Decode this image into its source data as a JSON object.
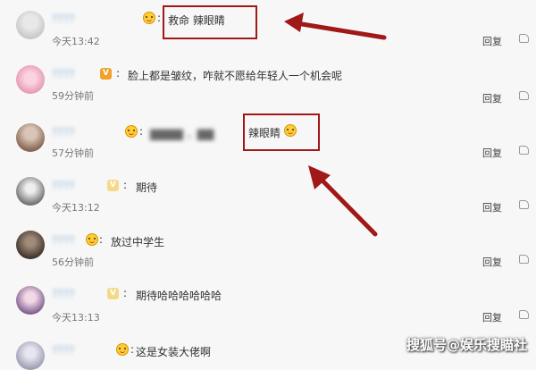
{
  "comments": [
    {
      "name": "????",
      "text": "救命 辣眼睛",
      "time": "今天13:42",
      "reply": "回复"
    },
    {
      "name": "????",
      "text": "脸上都是皱纹，咋就不愿给年轻人一个机会呢",
      "time": "59分钟前",
      "reply": "回复"
    },
    {
      "name": "????",
      "text": "辣眼睛",
      "time": "57分钟前",
      "reply": "回复"
    },
    {
      "name": "????",
      "text": "期待",
      "time": "今天13:12",
      "reply": "回复"
    },
    {
      "name": "????",
      "text": "放过中学生",
      "time": "56分钟前",
      "reply": "回复"
    },
    {
      "name": "????",
      "text": "期待哈哈哈哈哈哈",
      "time": "今天13:13",
      "reply": "回复"
    },
    {
      "name": "????",
      "text": "这是女装大佬啊",
      "time": "",
      "reply": ""
    }
  ],
  "badges": {
    "v_letter": "V"
  },
  "like_icon": "thumbs-up-icon",
  "watermark": "搜狐号@娱乐搜瞄社",
  "colors": {
    "highlight_box": "#a01818",
    "arrow": "#a01818"
  }
}
